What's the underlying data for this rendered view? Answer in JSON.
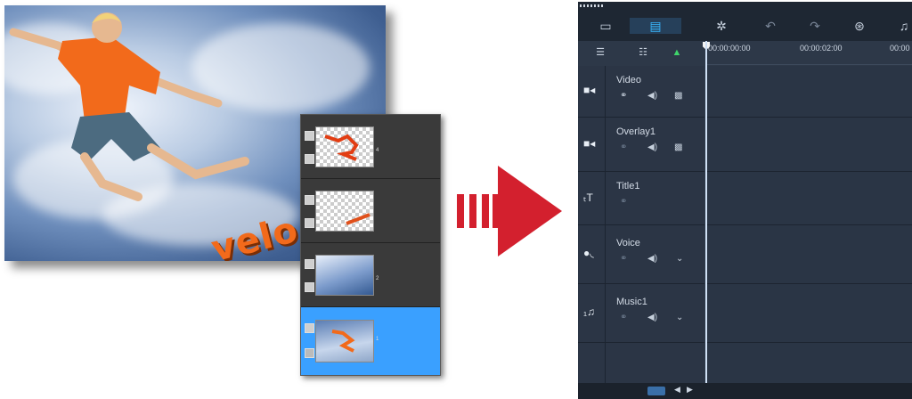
{
  "photo": {
    "text_overlay": "velo"
  },
  "layers_panel": {
    "layers": [
      {
        "number": "4",
        "content": "boy cutout"
      },
      {
        "number": "",
        "content": "text layer"
      },
      {
        "number": "2",
        "content": "sky"
      },
      {
        "number": "1",
        "content": "full photo",
        "selected": true
      }
    ]
  },
  "editor": {
    "toolbar": {
      "icons": [
        "storyboard-view-icon",
        "timeline-view-icon",
        "tools-icon",
        "undo-icon",
        "redo-icon",
        "record-capture-icon",
        "auto-music-icon"
      ]
    },
    "ruler": {
      "timecodes": [
        "00:00:00:00",
        "00:00:02:00",
        "00:00"
      ]
    },
    "tracks": [
      {
        "name": "Video",
        "icon": "video-track-icon"
      },
      {
        "name": "Overlay1",
        "icon": "overlay-track-icon"
      },
      {
        "name": "Title1",
        "icon": "title-track-icon"
      },
      {
        "name": "Voice",
        "icon": "voice-track-icon"
      },
      {
        "name": "Music1",
        "icon": "music-track-icon"
      }
    ],
    "accent_color": "#3aa0ff",
    "arrow_color": "#d3202e"
  }
}
